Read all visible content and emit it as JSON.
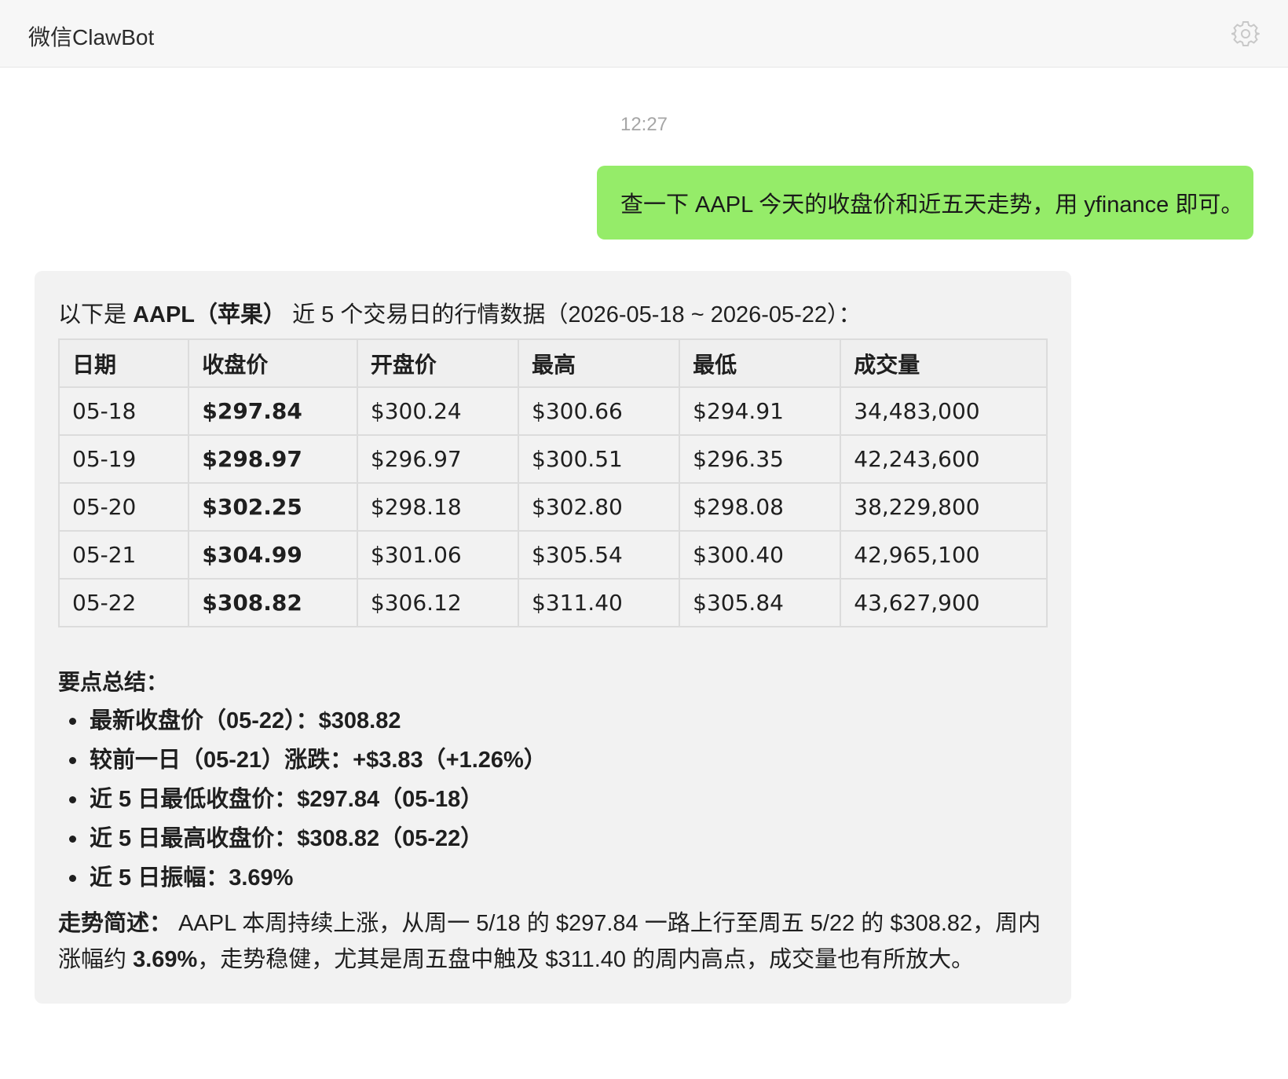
{
  "header": {
    "title": "微信ClawBot",
    "settings_icon": "gear-icon"
  },
  "chat": {
    "timestamp": "12:27",
    "user_message": "查一下 AAPL 今天的收盘价和近五天走势，用 yfinance 即可。",
    "user_bubble_color": "#95ec69",
    "bot": {
      "intro_prefix": "以下是 ",
      "intro_bold": "AAPL（苹果）",
      "intro_suffix": " 近 5 个交易日的行情数据（2026-05-18 ~ 2026-05-22）：",
      "table": {
        "headers": [
          "日期",
          "收盘价",
          "开盘价",
          "最高",
          "最低",
          "成交量"
        ],
        "rows": [
          [
            "05-18",
            "$297.84",
            "$300.24",
            "$300.66",
            "$294.91",
            "34,483,000"
          ],
          [
            "05-19",
            "$298.97",
            "$296.97",
            "$300.51",
            "$296.35",
            "42,243,600"
          ],
          [
            "05-20",
            "$302.25",
            "$298.18",
            "$302.80",
            "$298.08",
            "38,229,800"
          ],
          [
            "05-21",
            "$304.99",
            "$301.06",
            "$305.54",
            "$300.40",
            "42,965,100"
          ],
          [
            "05-22",
            "$308.82",
            "$306.12",
            "$311.40",
            "$305.84",
            "43,627,900"
          ]
        ]
      },
      "summary_title": "要点总结：",
      "points": [
        "最新收盘价（05-22）：$308.82",
        "较前一日（05-21）涨跌：+$3.83（+1.26%）",
        "近 5 日最低收盘价：$297.84（05-18）",
        "近 5 日最高收盘价：$308.82（05-22）",
        "近 5 日振幅：3.69%"
      ],
      "trend_label": "走势简述：",
      "trend_text_1": " AAPL 本周持续上涨，从周一 5/18 的 $297.84 一路上行至周五 5/22 的 $308.82，周内涨幅约 ",
      "trend_bold": "3.69%",
      "trend_text_2": "，走势稳健，尤其是周五盘中触及 $311.40 的周内高点，成交量也有所放大。"
    }
  }
}
